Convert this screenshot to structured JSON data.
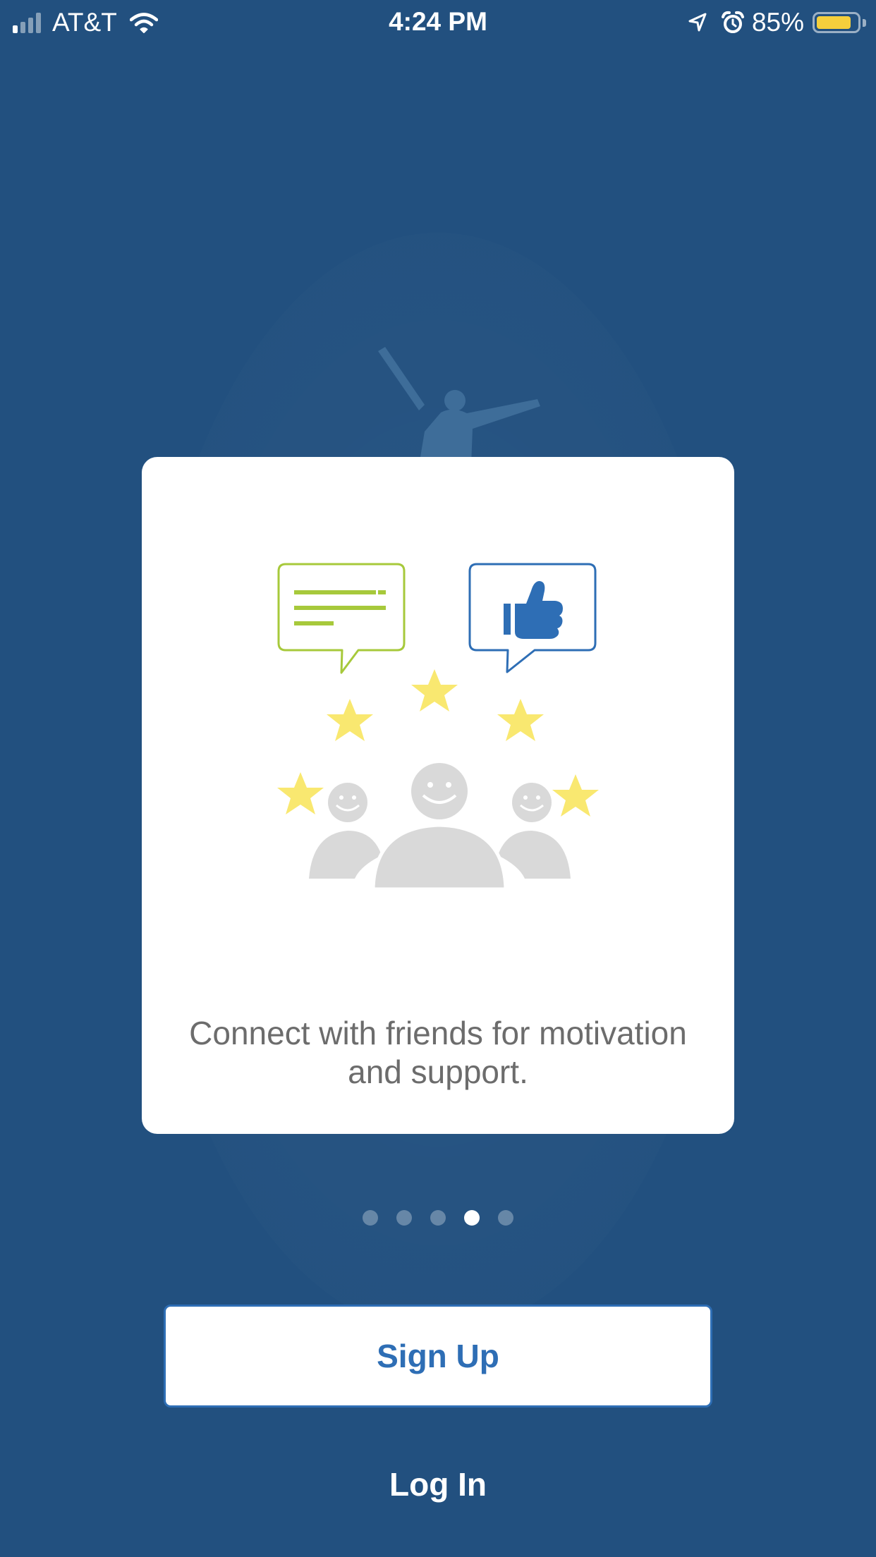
{
  "status_bar": {
    "carrier": "AT&T",
    "time": "4:24 PM",
    "battery_percent": "85%",
    "battery_level": 0.85,
    "icons": [
      "signal-icon",
      "wifi-icon",
      "location-arrow-icon",
      "alarm-icon",
      "battery-icon"
    ]
  },
  "onboarding": {
    "message": "Connect with friends for motivation and support.",
    "illustration": [
      "chat-bubble-icon",
      "thumbs-up-icon",
      "star-icon",
      "friends-group-icon"
    ],
    "pages_total": 5,
    "current_page": 4
  },
  "actions": {
    "signup_label": "Sign Up",
    "login_label": "Log In"
  },
  "colors": {
    "background": "#22507f",
    "brand_blue": "#2e6eb5",
    "chat_green": "#a7c93b",
    "star_yellow": "#f9e870",
    "people_gray": "#d9d9d9",
    "battery_yellow": "#f5cf3c"
  }
}
